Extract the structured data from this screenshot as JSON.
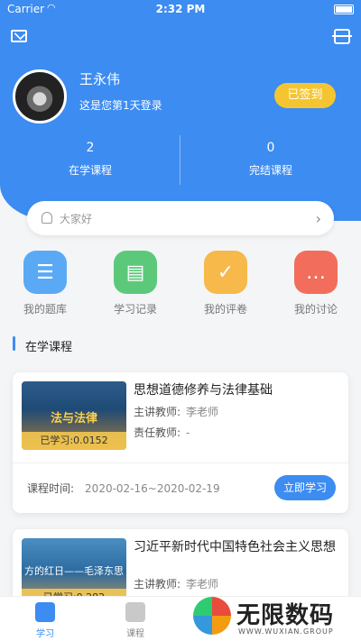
{
  "status_bar": {
    "carrier": "Carrier",
    "wifi_icon": "wifi-icon",
    "time": "2:32 PM"
  },
  "header": {
    "mail_icon": "mail-icon",
    "scan_icon": "scan-icon"
  },
  "profile": {
    "name": "王永伟",
    "login_days_text": "这是您第1天登录",
    "checkin_label": "已签到"
  },
  "stats": [
    {
      "value": "2",
      "label": "在学课程"
    },
    {
      "value": "0",
      "label": "完结课程"
    }
  ],
  "notice": {
    "text": "大家好"
  },
  "quick_actions": [
    {
      "label": "我的题库",
      "icon": "question-bank-icon",
      "color": "#5aa9f5"
    },
    {
      "label": "学习记录",
      "icon": "book-record-icon",
      "color": "#5cc97a"
    },
    {
      "label": "我的评卷",
      "icon": "checklist-icon",
      "color": "#f7b94a"
    },
    {
      "label": "我的讨论",
      "icon": "chat-icon",
      "color": "#f26d5b"
    }
  ],
  "section": {
    "title": "在学课程"
  },
  "courses": [
    {
      "title": "思想道德修养与法律基础",
      "teacher_label": "主讲教师:",
      "teacher": "李老师",
      "duty_label": "责任教师:",
      "duty": "-",
      "thumb_text": "法与法律",
      "progress": "已学习:0.0152",
      "time_label": "课程时间:",
      "time": "2020-02-16~2020-02-19",
      "button": "立即学习"
    },
    {
      "title": "习近平新时代中国特色社会主义思想",
      "teacher_label": "主讲教师:",
      "teacher": "李老师",
      "thumb_text": "方的红日——毛泽东思",
      "progress": "已学习:0.282"
    }
  ],
  "tabs": [
    {
      "label": "学习",
      "active": true
    },
    {
      "label": "课程",
      "active": false
    }
  ],
  "watermark": {
    "text": "无限数码",
    "sub": "WWW.WUXIAN.GROUP"
  },
  "colors": {
    "primary": "#3c8cf2",
    "checkin": "#f5c531"
  }
}
